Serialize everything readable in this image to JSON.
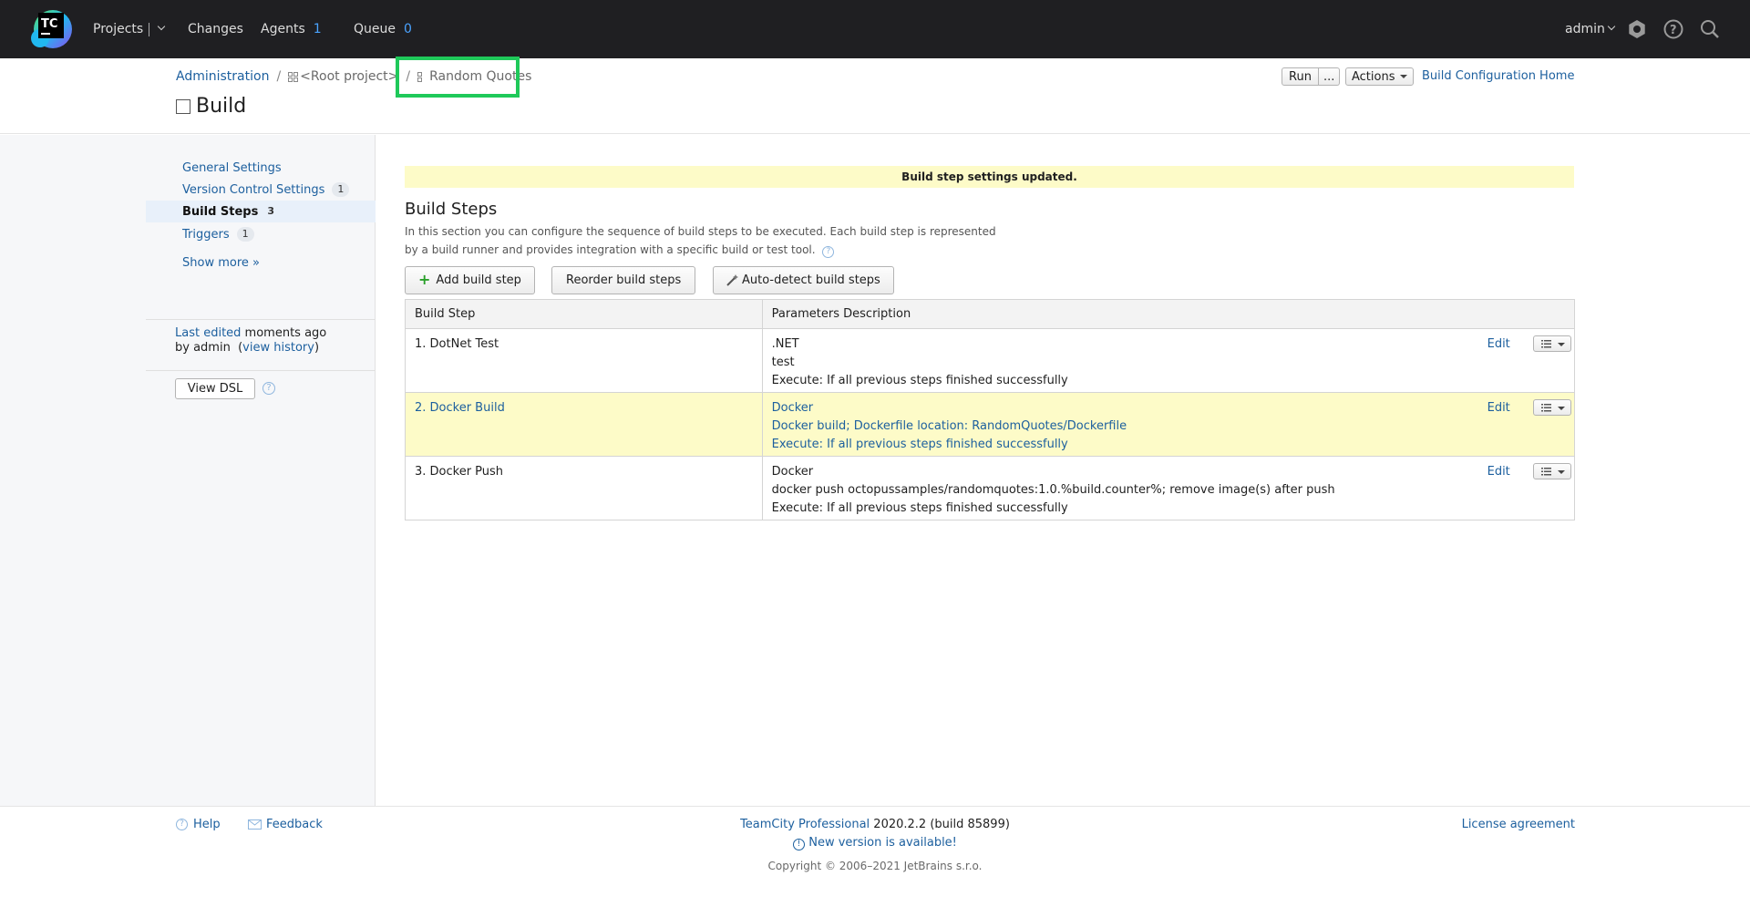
{
  "header": {
    "nav": {
      "projects": "Projects",
      "changes": "Changes",
      "agents": "Agents",
      "agents_count": "1",
      "queue": "Queue",
      "queue_count": "0"
    },
    "user": "admin",
    "icons": [
      "teamcity-logo",
      "settings-gear-icon",
      "help-icon",
      "search-icon"
    ]
  },
  "breadcrumb": {
    "items": [
      "Administration",
      "<Root project>",
      "Random Quotes"
    ]
  },
  "page": {
    "title": "Build",
    "run_label": "Run",
    "run_more": "...",
    "actions_label": "Actions",
    "config_home": "Build Configuration Home"
  },
  "sidebar": {
    "items": [
      {
        "label": "General Settings",
        "badge": ""
      },
      {
        "label": "Version Control Settings",
        "badge": "1"
      },
      {
        "label": "Build Steps",
        "badge": "3"
      },
      {
        "label": "Triggers",
        "badge": "1"
      }
    ],
    "show_more": "Show more »",
    "last_edited_link": "Last edited",
    "last_edited_rest": " moments ago",
    "by_text": "by admin",
    "view_history": "view history",
    "view_dsl": "View DSL"
  },
  "main": {
    "notice": "Build step settings updated.",
    "heading": "Build Steps",
    "desc_line1": "In this section you can configure the sequence of build steps to be executed. Each build step is represented",
    "desc_line2": "by a build runner and provides integration with a specific build or test tool.",
    "buttons": {
      "add": "Add build step",
      "reorder": "Reorder build steps",
      "autodetect": "Auto-detect build steps"
    },
    "table": {
      "col1": "Build Step",
      "col2": "Parameters Description",
      "edit_label": "Edit",
      "rows": [
        {
          "name": "1. DotNet Test",
          "lines": [
            ".NET",
            "test",
            "Execute: If all previous steps finished successfully"
          ]
        },
        {
          "name": "2. Docker Build",
          "lines": [
            "Docker",
            "Docker build; Dockerfile location: RandomQuotes/Dockerfile",
            "Execute: If all previous steps finished successfully"
          ]
        },
        {
          "name": "3. Docker Push",
          "lines": [
            "Docker",
            "docker push octopussamples/randomquotes:1.0.%build.counter%; remove image(s) after push",
            "Execute: If all previous steps finished successfully"
          ]
        }
      ]
    }
  },
  "footer": {
    "help": "Help",
    "feedback": "Feedback",
    "product": "TeamCity Professional",
    "version": " 2020.2.2 (build 85899)",
    "new_version": "New version is available!",
    "copyright": "Copyright © 2006–2021 JetBrains s.r.o.",
    "license": "License agreement"
  },
  "colors": {
    "header_bg": "#1f1f22",
    "link": "#1c5f9e",
    "highlight_row": "#fdfbc8",
    "focus_box": "#1fc95a",
    "count_blue": "#4aa3ff"
  }
}
